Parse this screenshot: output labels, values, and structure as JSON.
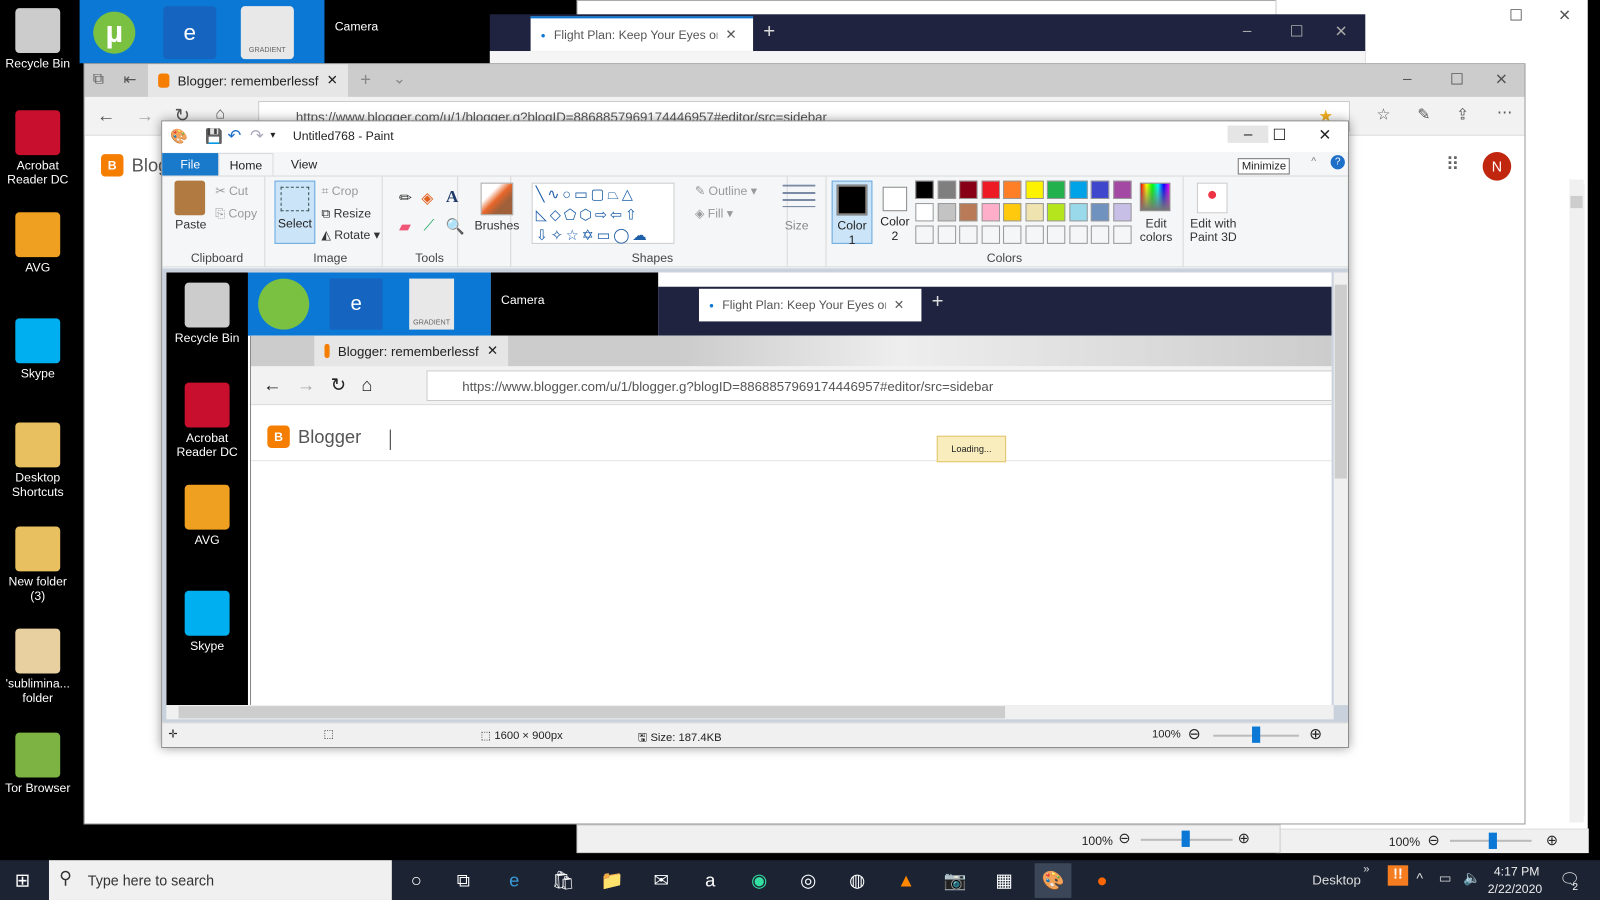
{
  "desktop": {
    "icons": [
      {
        "label": "Recycle Bin",
        "icon": "recycle-bin-icon"
      },
      {
        "label": "Acrobat Reader DC",
        "icon": "acrobat-icon"
      },
      {
        "label": "AVG",
        "icon": "avg-icon"
      },
      {
        "label": "Skype",
        "icon": "skype-icon"
      },
      {
        "label": "Desktop Shortcuts",
        "icon": "folder-icon"
      },
      {
        "label": "New folder (3)",
        "icon": "folder-icon"
      },
      {
        "label": "'sublimina... folder",
        "icon": "folder-icon"
      },
      {
        "label": "Tor Browser",
        "icon": "tor-icon"
      }
    ],
    "top_icons": [
      {
        "label": "",
        "icon": "utorrent-icon"
      },
      {
        "label": "e",
        "icon": "edge-icon"
      },
      {
        "label": "GRADIENT",
        "icon": "gradient-icon"
      }
    ],
    "camera_title": "Camera"
  },
  "dark_browser": {
    "tab_title": "Flight Plan: Keep Your Eyes on t",
    "new_tab": "+"
  },
  "edge": {
    "tab_title": "Blogger: rememberlessf",
    "url": "https://www.blogger.com/u/1/blogger.g?blogID=8868857969174446957#editor/src=sidebar",
    "page_logo_text": "Blogger",
    "avatar": "N",
    "zoom_back": "100%",
    "zoom_right": "100%"
  },
  "paint": {
    "title": "Untitled768 - Paint",
    "tabs": [
      "File",
      "Home",
      "View"
    ],
    "clipboard": {
      "paste": "Paste",
      "cut": "Cut",
      "copy": "Copy",
      "group": "Clipboard"
    },
    "image": {
      "select": "Select",
      "crop": "Crop",
      "resize": "Resize",
      "rotate": "Rotate",
      "group": "Image"
    },
    "tools": {
      "group": "Tools"
    },
    "brushes": "Brushes",
    "shapes": {
      "outline": "Outline",
      "fill": "Fill",
      "group": "Shapes"
    },
    "size": "Size",
    "color1": "Color 1",
    "color2": "Color 2",
    "colors_group": "Colors",
    "edit_colors": "Edit colors",
    "paint3d": "Edit with Paint 3D",
    "palette": [
      "#000000",
      "#7f7f7f",
      "#880015",
      "#ed1c24",
      "#ff7f27",
      "#fff200",
      "#22b14c",
      "#00a2e8",
      "#3f48cc",
      "#a349a4",
      "#ffffff",
      "#c3c3c3",
      "#b97a57",
      "#ffaec9",
      "#ffc90e",
      "#efe4b0",
      "#b5e61d",
      "#99d9ea",
      "#7092be",
      "#c8bfe7"
    ],
    "tooltip": "Minimize",
    "status": {
      "dimensions": "1600 × 900px",
      "size": "Size: 187.4KB",
      "zoom": "100%"
    }
  },
  "nested": {
    "camera_title": "Camera",
    "tab_flight": "Flight Plan: Keep Your Eyes on t",
    "tab_blogger": "Blogger: rememberlessf",
    "url": "https://www.blogger.com/u/1/blogger.g?blogID=8868857969174446957#editor/src=sidebar",
    "logo_text": "Blogger",
    "loading": "Loading...",
    "icons": [
      "Recycle Bin",
      "Acrobat Reader DC",
      "AVG",
      "Skype"
    ],
    "gradient": "GRADIENT"
  },
  "taskbar": {
    "search_placeholder": "Type here to search",
    "desktop_label": "Desktop",
    "chevron": "»",
    "time": "4:17 PM",
    "date": "2/22/2020",
    "notifications": "2"
  }
}
